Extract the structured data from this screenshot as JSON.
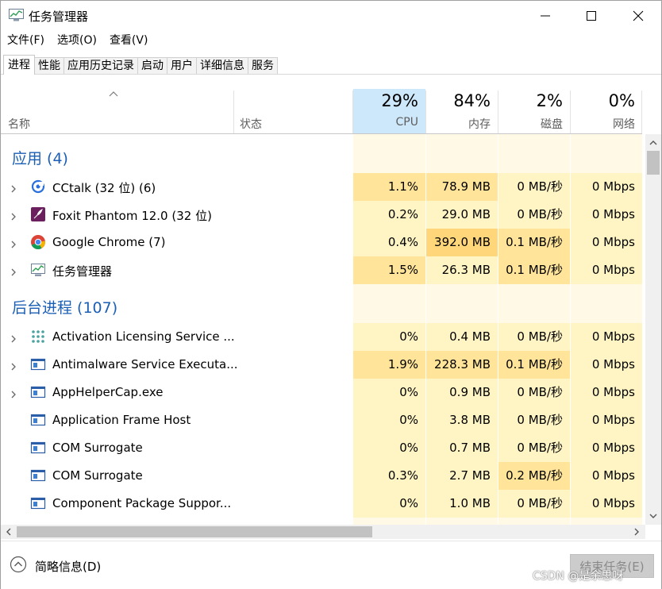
{
  "window": {
    "title": "任务管理器",
    "app_icon": "taskmgr-icon"
  },
  "menu": [
    "文件(F)",
    "选项(O)",
    "查看(V)"
  ],
  "tabs": [
    "进程",
    "性能",
    "应用历史记录",
    "启动",
    "用户",
    "详细信息",
    "服务"
  ],
  "active_tab": "进程",
  "columns": {
    "name": "名称",
    "status": "状态",
    "cpu": {
      "pct": "29%",
      "label": "CPU"
    },
    "memory": {
      "pct": "84%",
      "label": "内存"
    },
    "disk": {
      "pct": "2%",
      "label": "磁盘"
    },
    "network": {
      "pct": "0%",
      "label": "网络"
    }
  },
  "groups": {
    "apps": {
      "title": "应用 (4)"
    },
    "background": {
      "title": "后台进程 (107)"
    }
  },
  "rows": [
    {
      "name": "CCtalk (32 位) (6)",
      "icon": "cctalk-icon",
      "expandable": true,
      "cpu": "1.1%",
      "mem": "78.9 MB",
      "disk": "0 MB/秒",
      "net": "0 Mbps"
    },
    {
      "name": "Foxit Phantom 12.0 (32 位)",
      "icon": "foxit-icon",
      "expandable": true,
      "cpu": "0.2%",
      "mem": "29.0 MB",
      "disk": "0 MB/秒",
      "net": "0 Mbps"
    },
    {
      "name": "Google Chrome (7)",
      "icon": "chrome-icon",
      "expandable": true,
      "cpu": "0.4%",
      "mem": "392.0 MB",
      "disk": "0.1 MB/秒",
      "net": "0 Mbps"
    },
    {
      "name": "任务管理器",
      "icon": "taskmgr-icon",
      "expandable": true,
      "cpu": "1.5%",
      "mem": "26.3 MB",
      "disk": "0.1 MB/秒",
      "net": "0 Mbps"
    },
    {
      "name": "Activation Licensing Service ...",
      "icon": "service-dots-icon",
      "expandable": true,
      "cpu": "0%",
      "mem": "0.4 MB",
      "disk": "0 MB/秒",
      "net": "0 Mbps"
    },
    {
      "name": "Antimalware Service Executa...",
      "icon": "app-window-icon",
      "expandable": true,
      "cpu": "1.9%",
      "mem": "228.3 MB",
      "disk": "0.1 MB/秒",
      "net": "0 Mbps"
    },
    {
      "name": "AppHelperCap.exe",
      "icon": "app-window-icon",
      "expandable": true,
      "cpu": "0%",
      "mem": "0.9 MB",
      "disk": "0 MB/秒",
      "net": "0 Mbps"
    },
    {
      "name": "Application Frame Host",
      "icon": "app-window-icon",
      "expandable": false,
      "cpu": "0%",
      "mem": "3.8 MB",
      "disk": "0 MB/秒",
      "net": "0 Mbps"
    },
    {
      "name": "COM Surrogate",
      "icon": "app-window-icon",
      "expandable": false,
      "cpu": "0%",
      "mem": "0.7 MB",
      "disk": "0 MB/秒",
      "net": "0 Mbps"
    },
    {
      "name": "COM Surrogate",
      "icon": "app-window-icon",
      "expandable": false,
      "cpu": "0.3%",
      "mem": "2.7 MB",
      "disk": "0.2 MB/秒",
      "net": "0 Mbps"
    },
    {
      "name": "Component Package Suppor...",
      "icon": "app-window-icon",
      "expandable": false,
      "cpu": "0%",
      "mem": "1.0 MB",
      "disk": "0 MB/秒",
      "net": "0 Mbps"
    }
  ],
  "footer": {
    "fewer_details": "简略信息(D)",
    "end_task": "结束任务(E)"
  },
  "watermark": "CSDN @是余思呀",
  "colors": {
    "heat_0": "#fff4c4",
    "heat_1": "#ffe49a",
    "heat_2": "#ffd67a",
    "group_title": "#1b5fb5",
    "cpu_header": "#cde8fb"
  }
}
